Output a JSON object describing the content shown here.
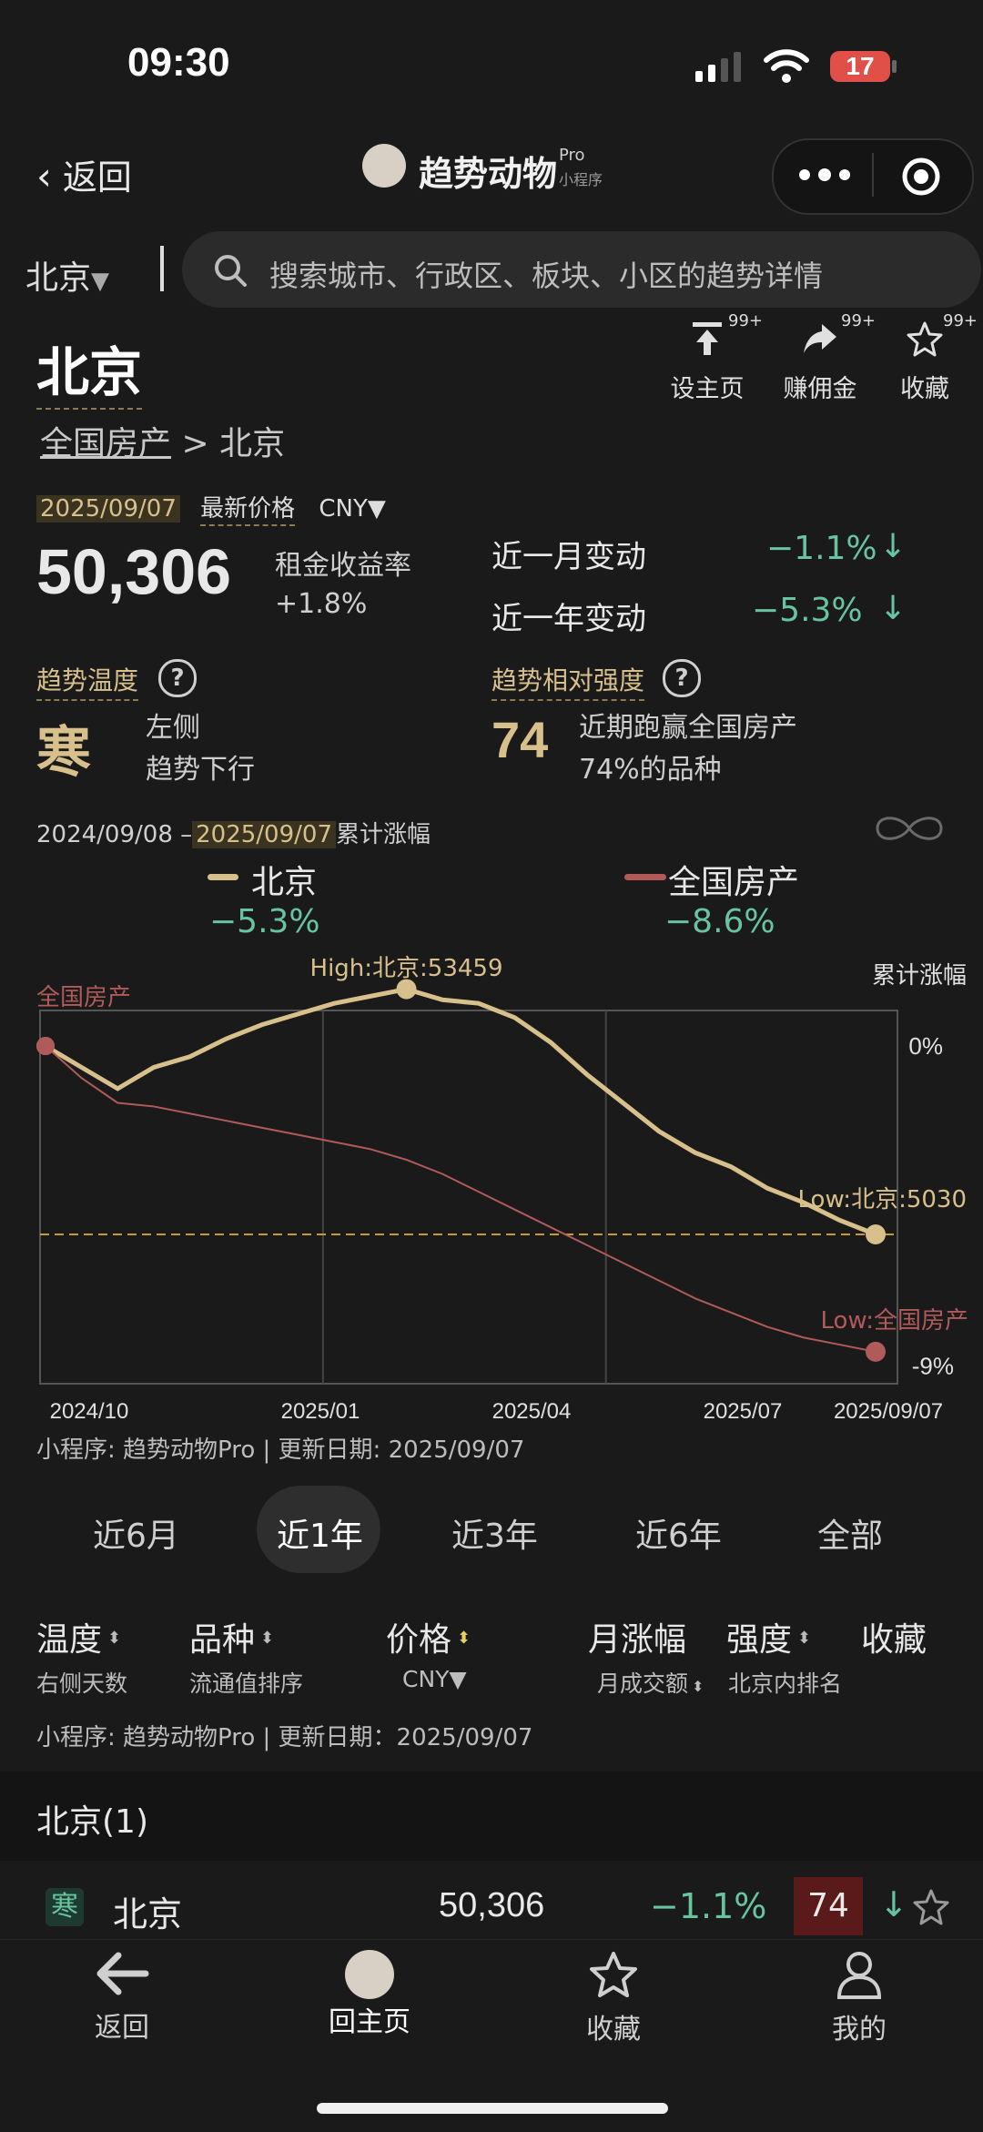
{
  "status": {
    "time": "09:30",
    "battery": "17"
  },
  "nav": {
    "back_label": "返回",
    "app_name": "趋势动物",
    "app_badge_pro": "Pro",
    "app_badge_mini": "小程序",
    "more_icon": "more-dots-icon",
    "close_icon": "target-icon"
  },
  "search": {
    "city": "北京",
    "placeholder": "搜索城市、行政区、板块、小区的趋势详情"
  },
  "header": {
    "title": "北京",
    "actions": [
      {
        "label": "设主页",
        "count": "99+",
        "icon": "pin-top-icon"
      },
      {
        "label": "赚佣金",
        "count": "99+",
        "icon": "share-arrow-icon"
      },
      {
        "label": "收藏",
        "count": "99+",
        "icon": "star-icon"
      }
    ],
    "breadcrumb_root": "全国房产",
    "breadcrumb_sep": ">",
    "breadcrumb_current": "北京"
  },
  "price": {
    "date": "2025/09/07",
    "latest_label": "最新价格",
    "currency": "CNY▼",
    "value": "50,306",
    "yield_label": "租金收益率",
    "yield_value": "+1.8%",
    "month_label": "近一月变动",
    "month_value": "−1.1%",
    "year_label": "近一年变动",
    "year_value": "−5.3%",
    "arrow": "↓"
  },
  "temperature": {
    "label": "趋势温度",
    "value": "寒",
    "line1": "左侧",
    "line2": "趋势下行"
  },
  "strength": {
    "label": "趋势相对强度",
    "value": "74",
    "line1": "近期跑赢全国房产",
    "line2": "74%的品种"
  },
  "chart_header": {
    "start": "2024/09/08",
    "dash": "–",
    "end": "2025/09/07",
    "suffix": "累计涨幅",
    "legend": [
      {
        "name": "北京",
        "value": "−5.3%",
        "color": "#d8c08c"
      },
      {
        "name": "全国房产",
        "value": "−8.6%",
        "color": "#b05a5a"
      }
    ]
  },
  "chart_data": {
    "type": "line",
    "ylabel": "累计涨幅",
    "x_ticks": [
      "2024/10",
      "2025/01",
      "2025/04",
      "2025/07",
      "2025/09/07"
    ],
    "y_ticks": [
      "0%",
      "-9%"
    ],
    "ylim": [
      -9.5,
      1.0
    ],
    "series": [
      {
        "name": "北京",
        "color": "#d8c08c",
        "values": [
          0,
          -0.6,
          -1.2,
          -0.6,
          -0.3,
          0.2,
          0.6,
          0.9,
          1.2,
          1.4,
          1.6,
          1.3,
          1.2,
          0.8,
          0.1,
          -0.8,
          -1.6,
          -2.4,
          -3.0,
          -3.4,
          -4.0,
          -4.4,
          -4.9,
          -5.3
        ]
      },
      {
        "name": "全国房产",
        "color": "#b05a5a",
        "values": [
          0,
          -0.9,
          -1.6,
          -1.7,
          -1.9,
          -2.1,
          -2.3,
          -2.5,
          -2.7,
          -2.9,
          -3.2,
          -3.6,
          -4.1,
          -4.6,
          -5.1,
          -5.6,
          -6.1,
          -6.6,
          -7.1,
          -7.5,
          -7.9,
          -8.2,
          -8.4,
          -8.6
        ]
      }
    ],
    "annotations": {
      "high": "High:北京:53459",
      "low_bj": "Low:北京:5030",
      "low_nat": "Low:全国房产",
      "start_label": "全国房产"
    }
  },
  "footnote": "小程序: 趋势动物Pro | 更新日期: 2025/09/07",
  "footnote2": "小程序: 趋势动物Pro | 更新日期：2025/09/07",
  "tabs": [
    "近6月",
    "近1年",
    "近3年",
    "近6年",
    "全部"
  ],
  "active_tab": "近1年",
  "table_header": {
    "c1": "温度",
    "c1_sub": "右侧天数",
    "c2": "品种",
    "c2_sub": "流通值排序",
    "c3": "价格",
    "c3_sub": "CNY▼",
    "c4": "月涨幅",
    "c4_sub": "月成交额",
    "c5": "强度",
    "c5_sub": "北京内排名",
    "c6": "收藏",
    "sort_icon": "sort-icon"
  },
  "section": {
    "title": "北京(1)"
  },
  "list": [
    {
      "temp": "寒",
      "name": "北京",
      "price": "50,306",
      "change": "−1.1%",
      "strength": "74",
      "arrow": "↓"
    }
  ],
  "bottom_nav": [
    {
      "label": "返回",
      "icon": "back-arrow-icon"
    },
    {
      "label": "回主页",
      "icon": "app-logo-icon"
    },
    {
      "label": "收藏",
      "icon": "star-icon"
    },
    {
      "label": "我的",
      "icon": "user-icon"
    }
  ]
}
